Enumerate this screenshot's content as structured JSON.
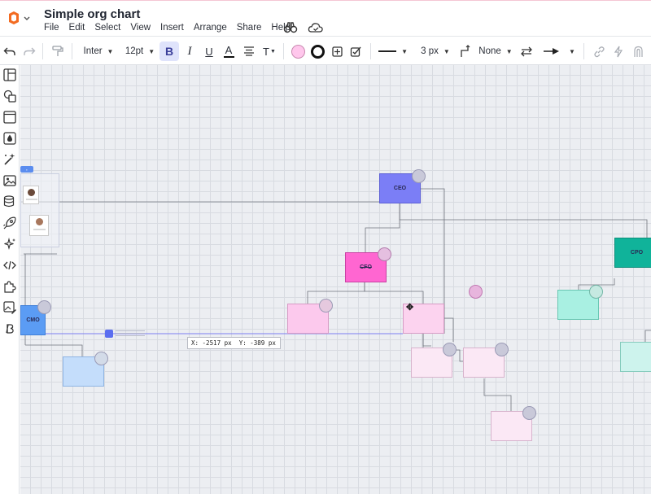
{
  "app": {
    "title": "Simple org chart",
    "menu": [
      "File",
      "Edit",
      "Select",
      "View",
      "Insert",
      "Arrange",
      "Share",
      "Help"
    ]
  },
  "toolbar": {
    "font_family": "Inter",
    "font_size": "12pt",
    "bold_label": "B",
    "italic_label": "I",
    "underline_label": "U",
    "font_color_label": "A",
    "text_options_label": "T",
    "fill_color": "#ffc7ec",
    "line_width": "3 px",
    "line_start": "None"
  },
  "canvas": {
    "coordinate_readout": "X: -2517 px  Y: -389 px",
    "nodes": [
      {
        "id": "ceo",
        "label": "CEO",
        "color": "#7b7ef6"
      },
      {
        "id": "cfo",
        "label": "CFO",
        "color": "#ff66d1"
      },
      {
        "id": "cpo",
        "label": "CPO",
        "color": "#10b39a"
      },
      {
        "id": "cmo",
        "label": "CMO",
        "color": "#5b9cf4"
      }
    ]
  },
  "icons": {
    "logo": "lucid-logo-icon",
    "cloud": "cloud-sync-icon"
  }
}
